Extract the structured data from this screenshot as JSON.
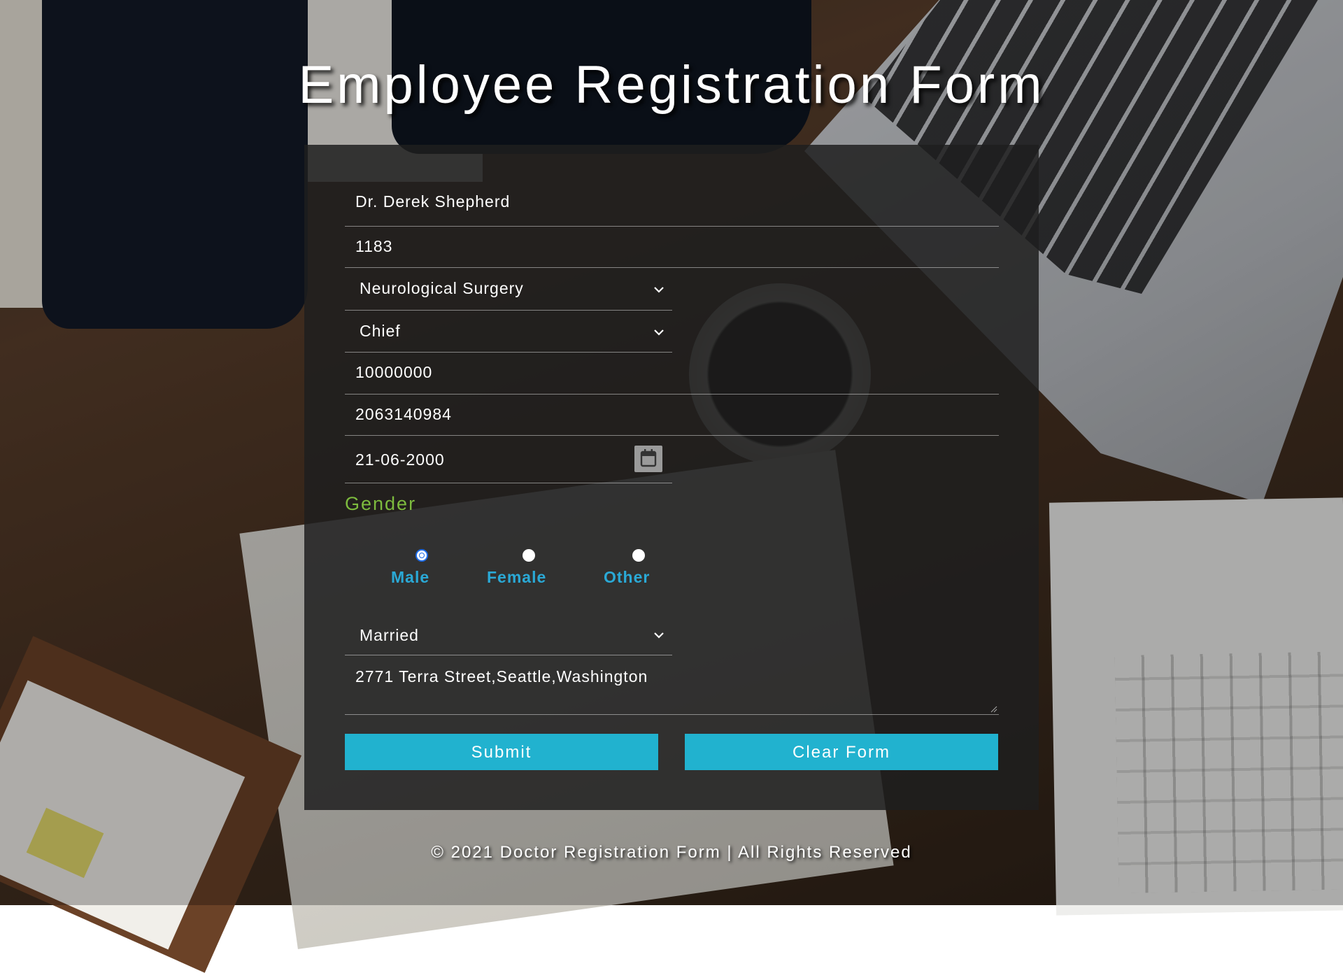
{
  "page": {
    "title": "Employee Registration Form",
    "footer": "© 2021 Doctor Registration Form | All Rights Reserved"
  },
  "form": {
    "name": "Dr. Derek Shepherd",
    "employee_id": "1183",
    "department": "Neurological Surgery",
    "designation": "Chief",
    "salary": "10000000",
    "phone": "2063140984",
    "dob": "21-06-2000",
    "gender_label": "Gender",
    "gender_options": [
      {
        "label": "Male",
        "checked": true
      },
      {
        "label": "Female",
        "checked": false
      },
      {
        "label": "Other",
        "checked": false
      }
    ],
    "marital_status": "Married",
    "address": "2771 Terra Street,Seattle,Washington",
    "submit_label": "Submit",
    "clear_label": "Clear Form"
  },
  "colors": {
    "accent_button": "#21b2cf",
    "radio_label": "#2aa9d6",
    "gender_label": "#7dbb3e",
    "radio_checked": "#1d6be6",
    "panel": "#1e1e1e"
  },
  "icons": {
    "select_caret": "chevron-down-icon",
    "date_picker": "calendar-icon",
    "textarea_grip": "resize-grip-icon"
  }
}
